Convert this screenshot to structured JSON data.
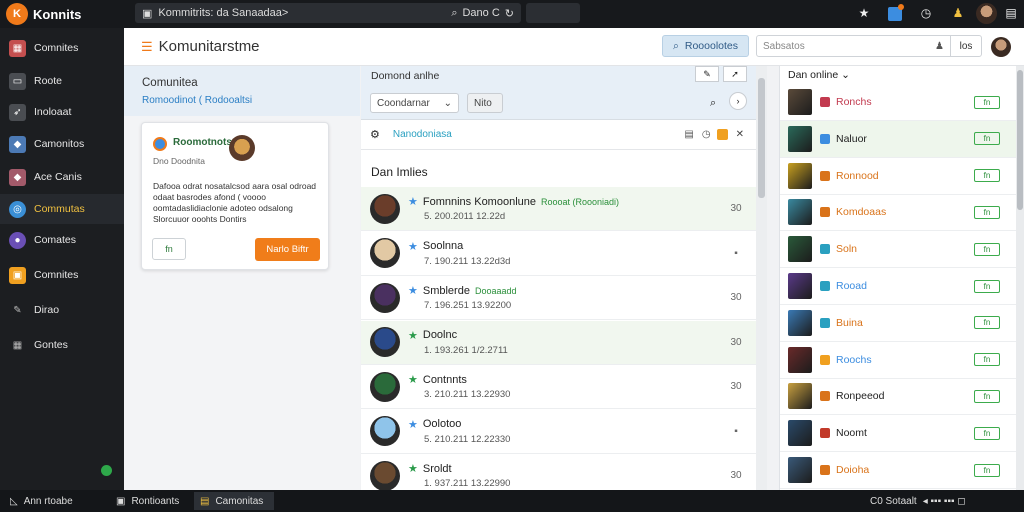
{
  "topbar": {
    "app_title": "Konnits",
    "search_text": "Kommitrits: da Sanaadaa>",
    "search_right": "Dano C"
  },
  "sidebar": {
    "items": [
      {
        "label": "Comnites",
        "icon": "community-grid-icon",
        "color": "#c44f4f"
      },
      {
        "label": "Roote",
        "icon": "home-icon",
        "color": "#6b6e73"
      },
      {
        "label": "Inoloaat",
        "icon": "rocket-icon",
        "color": "#6b6e73"
      },
      {
        "label": "Camonitos",
        "icon": "game-tile-icon",
        "color": "#4c7ab5"
      },
      {
        "label": "Ace Canis",
        "icon": "game-tile-icon",
        "color": "#a35a6a"
      },
      {
        "label": "Commutas",
        "icon": "globe-icon",
        "color": "#3a8fd6",
        "active": true
      },
      {
        "label": "Comates",
        "icon": "badge-icon",
        "color": "#6a4fb5"
      },
      {
        "label": "Comnites",
        "icon": "chat-icon",
        "color": "#f0a020"
      },
      {
        "label": "Dirao",
        "icon": "wrench-icon",
        "color": "#6b6e73"
      },
      {
        "label": "Gontes",
        "icon": "grid-icon",
        "color": "#6b6e73"
      }
    ],
    "status_dot_color": "#2ea84a"
  },
  "taskbar": {
    "items": [
      "Ann rtoabe",
      "Rontioants",
      "Camonitas"
    ],
    "right_text": "C0 Sotaalt"
  },
  "header": {
    "title": "Komunitarstme",
    "button_label": "Roooolotes",
    "search_placeholder": "Sabsatos",
    "search_btn": "los"
  },
  "left": {
    "heading": "Comunitea",
    "link": "Romoodinot ( Rodooaltsi",
    "card": {
      "name": "Roomotnots",
      "sub": "Dno Doodnita",
      "body": "Dafooa odrat nosatalcsod aara osal odroad odaat basrodes afond ( voooo oomtadaslidiaclonie adoteo odsalong Slorcuuor ooohts Dontirs",
      "btn_ghost": "fn",
      "btn_primary": "Narlo Biftr"
    }
  },
  "main": {
    "top_label": "Domond anlhe",
    "select_value": "Coondarnar",
    "select_btn": "Nito",
    "tab_label": "Nanodoniasa",
    "section": "Dan Imlies",
    "rows": [
      {
        "name": "Fomnnins Komoonlune",
        "tag": "Roooat (Roooniadi)",
        "meta": "5. 200.2011 12.22d",
        "act": "30",
        "star": "#3c8de0",
        "alt": true,
        "av": "#6a3d2a"
      },
      {
        "name": "Soolnna",
        "tag": "",
        "meta": "7. 190.211 13.22d3d",
        "act": "▪",
        "star": "#3c8de0",
        "alt": false,
        "av": "#e2c9a4"
      },
      {
        "name": "Smblerde",
        "tag": "Dooaaadd",
        "meta": "7. 196.251 13.92200",
        "act": "30",
        "star": "#3c8de0",
        "alt": false,
        "av": "#4a3060"
      },
      {
        "name": "Doolnc",
        "tag": "",
        "meta": "1. 193.261 1/2.2711",
        "act": "30",
        "star": "#2a9a4a",
        "alt": true,
        "av": "#2a4a8a"
      },
      {
        "name": "Contnnts",
        "tag": "",
        "meta": "3. 210.211 13.22930",
        "act": "30",
        "star": "#2a9a4a",
        "alt": false,
        "av": "#2a6a3a"
      },
      {
        "name": "Oolotoo",
        "tag": "",
        "meta": "5. 210.211 12.22330",
        "act": "▪",
        "star": "#3c8de0",
        "alt": false,
        "av": "#8fc4ea"
      },
      {
        "name": "Sroldt",
        "tag": "",
        "meta": "1. 937.211 13.22990",
        "act": "30",
        "star": "#2a9a4a",
        "alt": false,
        "av": "#6a4a30"
      }
    ]
  },
  "right": {
    "heading": "Dan online",
    "friends": [
      {
        "name": "Ronchs",
        "color": "#c23a4f",
        "badge": "#c23a4f",
        "alt": false,
        "av": "#5a4a3a"
      },
      {
        "name": "Naluor",
        "color": "#222222",
        "badge": "#3c8de0",
        "alt": true,
        "av": "#2a6a5a"
      },
      {
        "name": "Ronnood",
        "color": "#d9731a",
        "badge": "#d9731a",
        "alt": false,
        "av": "#c8a020"
      },
      {
        "name": "Komdoaas",
        "color": "#d9731a",
        "badge": "#d9731a",
        "alt": false,
        "av": "#3a8aa0"
      },
      {
        "name": "Soln",
        "color": "#d9731a",
        "badge": "#2aa0c0",
        "alt": false,
        "av": "#2a5a3a"
      },
      {
        "name": "Rooad",
        "color": "#3c8de0",
        "badge": "#2aa0c0",
        "alt": false,
        "av": "#5a3a8a"
      },
      {
        "name": "Buina",
        "color": "#d9731a",
        "badge": "#2aa0c0",
        "alt": false,
        "av": "#3a7ab5"
      },
      {
        "name": "Roochs",
        "color": "#3c8de0",
        "badge": "#f0a020",
        "alt": false,
        "av": "#6a2a2a"
      },
      {
        "name": "Ronpeeod",
        "color": "#222222",
        "badge": "#d9731a",
        "alt": false,
        "av": "#c8a040"
      },
      {
        "name": "Noomt",
        "color": "#222222",
        "badge": "#c23a2a",
        "alt": false,
        "av": "#2a4a6a"
      },
      {
        "name": "Doioha",
        "color": "#d9731a",
        "badge": "#d9731a",
        "alt": false,
        "av": "#3a5a7a"
      }
    ],
    "friend_btn": "fn"
  }
}
